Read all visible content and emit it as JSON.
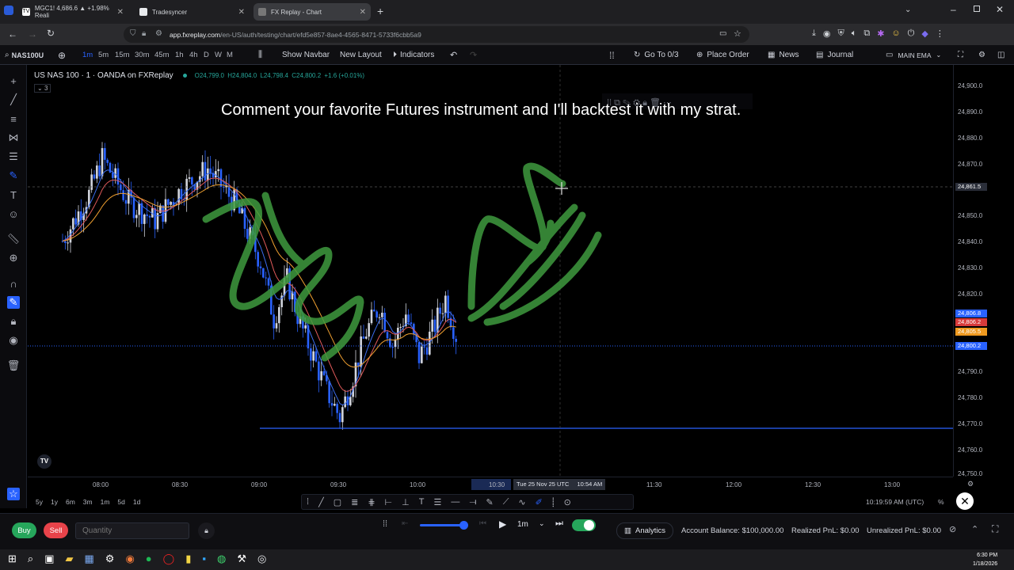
{
  "browser": {
    "tabs": [
      {
        "label": "MGC1! 4,686.6 ▲ +1.98% Reali",
        "favicon_color": "#2a5bd7"
      },
      {
        "label": "Tradesyncer",
        "favicon_color": "#e8eaed"
      },
      {
        "label": "FX Replay - Chart",
        "favicon_color": "#6e6e6e"
      }
    ],
    "new_tab": "+",
    "url_host": "app.fxreplay.com",
    "url_path": "/en-US/auth/testing/chart/efd5e857-8ae4-4565-8471-5733f6cbb5a9"
  },
  "toolbar": {
    "symbol": "NAS100U",
    "timeframes": [
      "1m",
      "5m",
      "15m",
      "30m",
      "45m",
      "1h",
      "4h",
      "D",
      "W",
      "M"
    ],
    "selected_timeframe": "1m",
    "show_navbar": "Show Navbar",
    "new_layout": "New Layout",
    "indicators": "Indicators",
    "go_to": "Go To 0/3",
    "place_order": "Place Order",
    "news": "News",
    "journal": "Journal",
    "layout_name": "MAIN EMA"
  },
  "chart": {
    "title": "US NAS 100 · 1 · OANDA on FXReplay",
    "open": "O24,799.0",
    "high": "H24,804.0",
    "low": "L24,798.4",
    "close": "C24,800.2",
    "change": "+1.6 (+0.01%)",
    "indicator_count": "3",
    "overlay_comment": "Comment your favorite Futures instrument and I'll backtest it with my strat.",
    "y_ticks": [
      "24,900.0",
      "24,890.0",
      "24,880.0",
      "24,870.0",
      "24,861.5",
      "24,850.0",
      "24,840.0",
      "24,830.0",
      "24,820.0",
      "24,806.8",
      "24,806.2",
      "24,805.5",
      "24,800.2",
      "24,790.0",
      "24,780.0",
      "24,770.0",
      "24,760.0",
      "24,750.0"
    ],
    "x_ticks": [
      "08:00",
      "08:30",
      "09:00",
      "09:30",
      "10:00",
      "10:30",
      "11:30",
      "12:00",
      "12:30",
      "13:00"
    ],
    "crosshair_time": "Tue 25 Nov 25 UTC",
    "crosshair_time2": "10:54 AM",
    "colors": {
      "up": "#d1d4dc",
      "down": "#2962ff",
      "ema_fast": "#e05a5a",
      "ema_slow": "#f0a030",
      "ema_blue": "#3b6df0",
      "drawing": "#3e9a3e"
    }
  },
  "chart_data": {
    "type": "candlestick",
    "title": "US NAS 100 · 1 · OANDA on FXReplay",
    "ylim": [
      24750,
      24905
    ],
    "x_range": [
      "07:45",
      "13:20"
    ],
    "horizontal_lines": [
      24800.2,
      24770.0,
      24861.5
    ],
    "close_series": [
      {
        "t": "07:45",
        "v": 24840
      },
      {
        "t": "07:55",
        "v": 24858
      },
      {
        "t": "08:00",
        "v": 24872
      },
      {
        "t": "08:10",
        "v": 24855
      },
      {
        "t": "08:20",
        "v": 24848
      },
      {
        "t": "08:30",
        "v": 24860
      },
      {
        "t": "08:40",
        "v": 24868
      },
      {
        "t": "08:50",
        "v": 24855
      },
      {
        "t": "09:00",
        "v": 24832
      },
      {
        "t": "09:05",
        "v": 24810
      },
      {
        "t": "09:10",
        "v": 24825
      },
      {
        "t": "09:15",
        "v": 24808
      },
      {
        "t": "09:20",
        "v": 24795
      },
      {
        "t": "09:25",
        "v": 24782
      },
      {
        "t": "09:30",
        "v": 24772
      },
      {
        "t": "09:35",
        "v": 24788
      },
      {
        "t": "09:40",
        "v": 24805
      },
      {
        "t": "09:45",
        "v": 24815
      },
      {
        "t": "09:50",
        "v": 24800
      },
      {
        "t": "09:55",
        "v": 24812
      },
      {
        "t": "10:00",
        "v": 24795
      },
      {
        "t": "10:05",
        "v": 24805
      },
      {
        "t": "10:10",
        "v": 24818
      },
      {
        "t": "10:15",
        "v": 24800
      }
    ]
  },
  "bottombar": {
    "ranges": [
      "5y",
      "1y",
      "6m",
      "3m",
      "1m",
      "5d",
      "1d"
    ],
    "clock": "10:19:59 AM (UTC)",
    "pct": "%"
  },
  "trade": {
    "buy": "Buy",
    "sell": "Sell",
    "quantity_placeholder": "Quantity",
    "speed": "1m",
    "analytics": "Analytics",
    "balance": "Account Balance: $100,000.00",
    "realized": "Realized PnL: $0.00",
    "unrealized": "Unrealized PnL: $0.00"
  },
  "taskbar": {
    "time": "6:30 PM",
    "date": "1/18/2026"
  }
}
